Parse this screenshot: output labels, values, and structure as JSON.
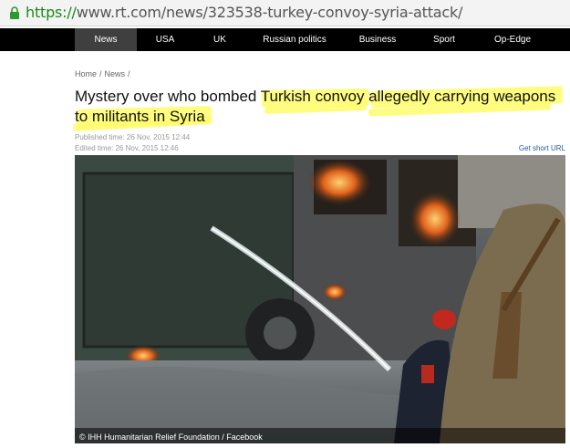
{
  "browser": {
    "url_scheme": "https://",
    "url_rest": "www.rt.com/news/323538-turkey-convoy-syria-attack/"
  },
  "nav": {
    "items": [
      {
        "label": "News",
        "active": true
      },
      {
        "label": "USA",
        "active": false
      },
      {
        "label": "UK",
        "active": false
      },
      {
        "label": "Russian politics",
        "active": false
      },
      {
        "label": "Business",
        "active": false
      },
      {
        "label": "Sport",
        "active": false
      },
      {
        "label": "Op-Edge",
        "active": false
      }
    ]
  },
  "breadcrumb": [
    "Home",
    "/",
    "News",
    "/"
  ],
  "article": {
    "headline_line1": "Mystery over who bombed Turkish convoy allegedly carrying weapons",
    "headline_line2": "to militants in Syria",
    "published": "Published time: 26 Nov, 2015 12:44",
    "edited": "Edited time: 26 Nov, 2015 12:46",
    "short_url": "Get short URL",
    "photo_caption": "© IHH Humanitarian Relief Foundation / Facebook"
  },
  "colors": {
    "nav_bg": "#000000",
    "nav_active": "#3f3f3f",
    "highlight": "#fffd6a",
    "link": "#1b5fa6",
    "url_green": "#1a8a1a"
  },
  "icons": [
    "lock-icon"
  ]
}
